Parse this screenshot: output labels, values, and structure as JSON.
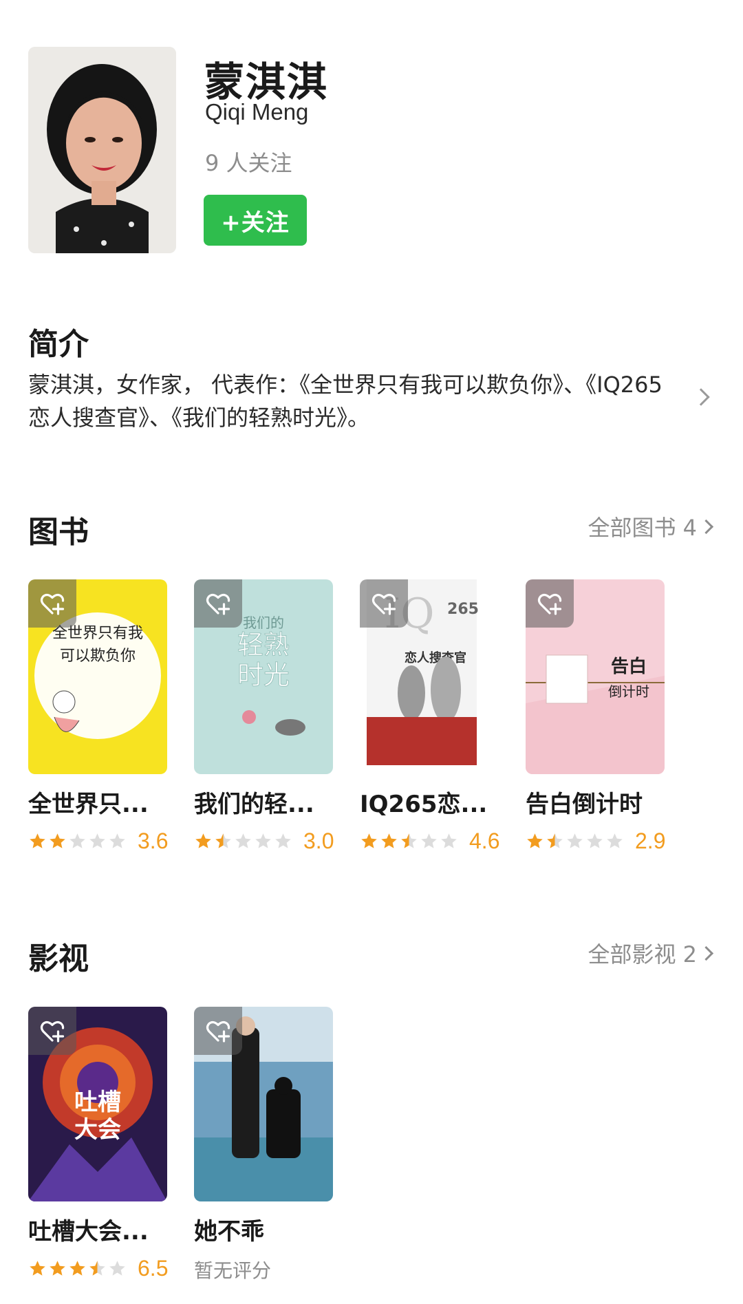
{
  "profile": {
    "name": "蒙淇淇",
    "name_en": "Qiqi Meng",
    "followers": "9 人关注",
    "follow_button": "+关注"
  },
  "intro": {
    "title": "简介",
    "text": "蒙淇淇，女作家， 代表作：《全世界只有我可以欺负你》、《IQ265恋人搜查官》、《我们的轻熟时光》。"
  },
  "books": {
    "title": "图书",
    "more": "全部图书 4",
    "items": [
      {
        "title": "全世界只...",
        "stars": 2,
        "score": "3.6",
        "cover_text": [
          "全世界只有我",
          "可以欺负你"
        ],
        "cover_color": "#f7e321"
      },
      {
        "title": "我们的轻...",
        "stars": 1.5,
        "score": "3.0",
        "cover_text": [
          "我们的",
          "轻熟",
          "时光"
        ],
        "cover_color": "#bfe0dc"
      },
      {
        "title": "IQ265恋...",
        "stars": 2.5,
        "score": "4.6",
        "cover_text": [
          "IQ",
          "265",
          "恋人搜查官"
        ],
        "cover_color": "#f4f4f4"
      },
      {
        "title": "告白倒计时",
        "stars": 1.5,
        "score": "2.9",
        "cover_text": [
          "告白",
          "倒计时"
        ],
        "cover_color": "#f6d0d8"
      }
    ]
  },
  "videos": {
    "title": "影视",
    "more": "全部影视 2",
    "items": [
      {
        "title": "吐槽大会...",
        "stars": 3.5,
        "score": "6.5",
        "cover_text": [
          "吐槽",
          "大会"
        ]
      },
      {
        "title": "她不乖",
        "no_score": "暂无评分"
      }
    ]
  },
  "colors": {
    "accent_green": "#2fbd4d",
    "star_orange": "#f29c1f",
    "star_gray": "#dcdcdc",
    "muted_text": "#8d8d8d"
  },
  "icons": [
    "chevron-right-icon",
    "star-icon",
    "heart-plus-icon"
  ]
}
